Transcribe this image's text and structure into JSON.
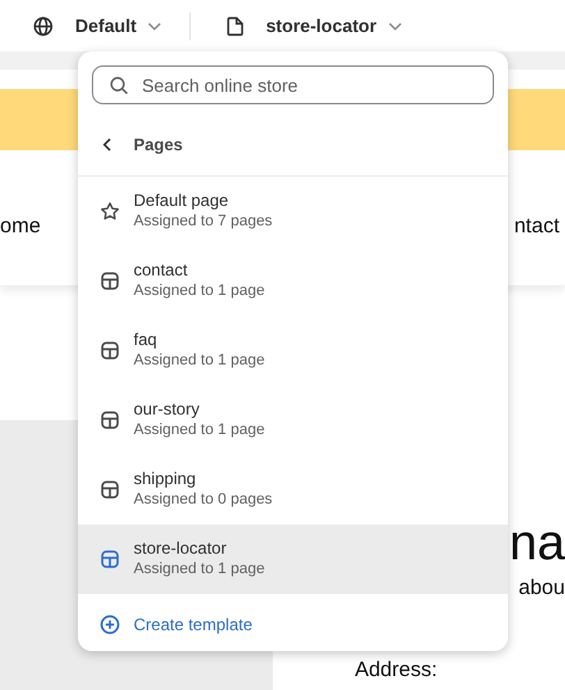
{
  "top_bar": {
    "theme": {
      "label": "Default"
    },
    "template": {
      "label": "store-locator"
    }
  },
  "background": {
    "nav_left": "ome",
    "nav_right": "ntact",
    "heading": "na",
    "text": "abou",
    "address_label": "Address:"
  },
  "popover": {
    "search": {
      "placeholder": "Search online store"
    },
    "header": "Pages",
    "items": [
      {
        "kind": "default",
        "title": "Default page",
        "subtitle": "Assigned to 7 pages",
        "selected": false
      },
      {
        "kind": "template",
        "title": "contact",
        "subtitle": "Assigned to 1 page",
        "selected": false
      },
      {
        "kind": "template",
        "title": "faq",
        "subtitle": "Assigned to 1 page",
        "selected": false
      },
      {
        "kind": "template",
        "title": "our-story",
        "subtitle": "Assigned to 1 page",
        "selected": false
      },
      {
        "kind": "template",
        "title": "shipping",
        "subtitle": "Assigned to 0 pages",
        "selected": false
      },
      {
        "kind": "template",
        "title": "store-locator",
        "subtitle": "Assigned to 1 page",
        "selected": true
      }
    ],
    "create": "Create template"
  }
}
